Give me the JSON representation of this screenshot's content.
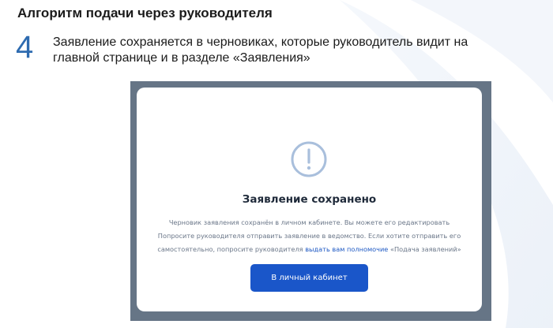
{
  "slide": {
    "title": "Алгоритм подачи через руководителя",
    "step_number": "4",
    "step_text": "Заявление сохраняется в черновиках, которые руководитель видит на главной странице и в разделе «Заявления»"
  },
  "modal": {
    "icon": "exclamation-circle-icon",
    "title": "Заявление сохранено",
    "body_line1": "Черновик заявления сохранён в личном кабинете. Вы можете его редактировать",
    "body_line2": "Попросите руководителя отправить заявление в ведомство. Если хотите отправить его",
    "body_line3_before": "самостоятельно, попросите руководителя ",
    "body_line3_link": "выдать вам полномочие",
    "body_line3_after": " «Подача заявлений»",
    "button_label": "В личный кабинет"
  },
  "colors": {
    "accent_number": "#2e6bb0",
    "frame_background": "#667586",
    "button_background": "#1a56c9",
    "link": "#1f5ac4",
    "icon_stroke": "#a9bfdc"
  }
}
